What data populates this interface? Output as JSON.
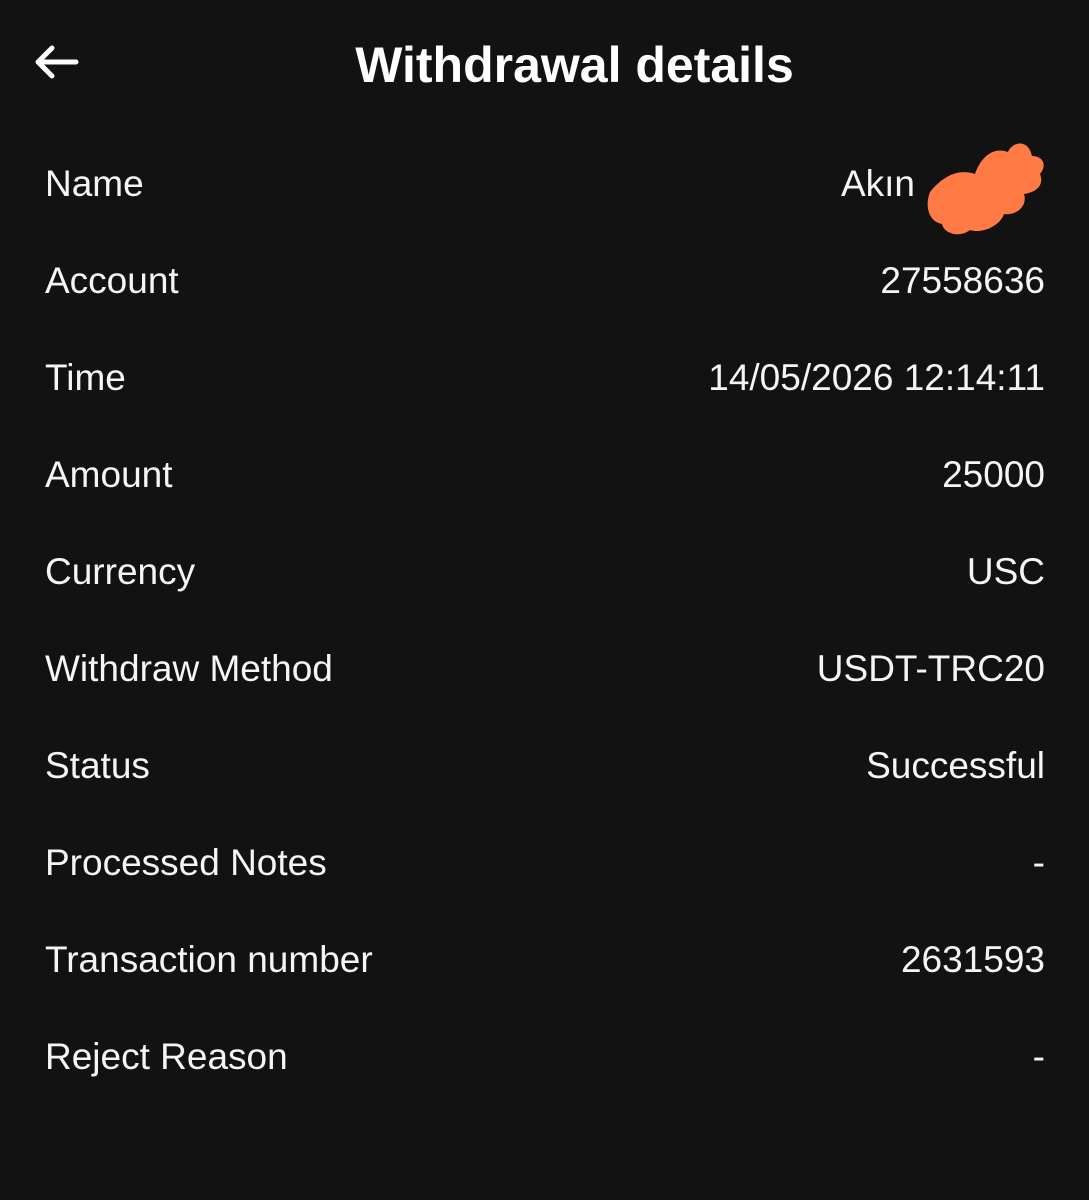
{
  "header": {
    "title": "Withdrawal details",
    "back_icon": "arrow-left-icon"
  },
  "colors": {
    "background": "#121212",
    "text": "#ffffff",
    "redaction": "#ff7a45"
  },
  "details": [
    {
      "label": "Name",
      "value": "Akın"
    },
    {
      "label": "Account",
      "value": "27558636"
    },
    {
      "label": "Time",
      "value": "14/05/2026 12:14:11"
    },
    {
      "label": "Amount",
      "value": "25000"
    },
    {
      "label": "Currency",
      "value": "USC"
    },
    {
      "label": "Withdraw Method",
      "value": "USDT-TRC20"
    },
    {
      "label": "Status",
      "value": "Successful"
    },
    {
      "label": "Processed Notes",
      "value": "-"
    },
    {
      "label": "Transaction number",
      "value": "2631593"
    },
    {
      "label": "Reject Reason",
      "value": "-"
    }
  ]
}
